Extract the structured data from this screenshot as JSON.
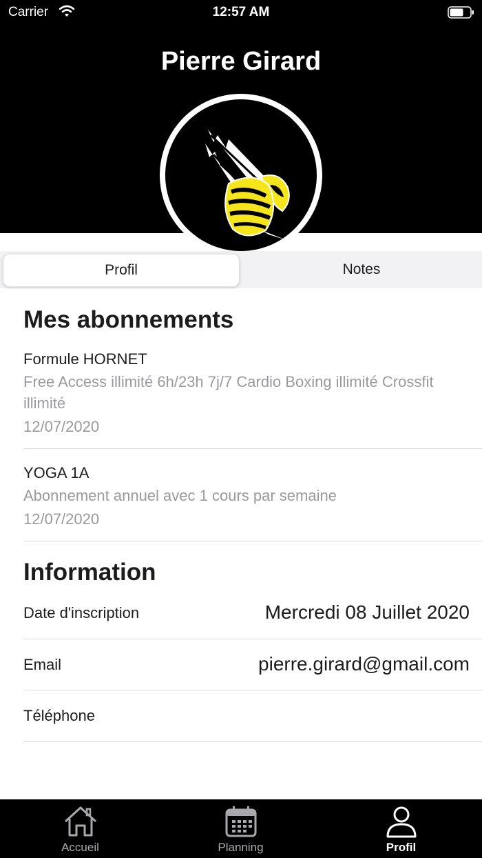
{
  "status_bar": {
    "carrier": "Carrier",
    "time": "12:57 AM"
  },
  "profile": {
    "name": "Pierre Girard"
  },
  "segments": [
    {
      "label": "Profil",
      "active": true
    },
    {
      "label": "Notes",
      "active": false
    }
  ],
  "subscriptions": {
    "title": "Mes abonnements",
    "items": [
      {
        "name": "Formule HORNET",
        "description": "Free Access illimité 6h/23h 7j/7 Cardio Boxing illimité Crossfit illimité",
        "date": "12/07/2020"
      },
      {
        "name": "YOGA 1A",
        "description": "Abonnement annuel avec 1 cours par semaine",
        "date": "12/07/2020"
      }
    ]
  },
  "information": {
    "title": "Information",
    "rows": [
      {
        "label": "Date d'inscription",
        "value": "Mercredi 08 Juillet 2020"
      },
      {
        "label": "Email",
        "value": "pierre.girard@gmail.com"
      },
      {
        "label": "Téléphone",
        "value": ""
      }
    ]
  },
  "tabbar": {
    "items": [
      {
        "label": "Accueil",
        "icon": "home-icon",
        "active": false
      },
      {
        "label": "Planning",
        "icon": "calendar-icon",
        "active": false
      },
      {
        "label": "Profil",
        "icon": "person-icon",
        "active": true
      }
    ]
  },
  "colors": {
    "header_bg": "#000000",
    "hornet_yellow": "#f5e51b",
    "muted_text": "#9a9a9e",
    "tabbar_bg": "#000000"
  }
}
